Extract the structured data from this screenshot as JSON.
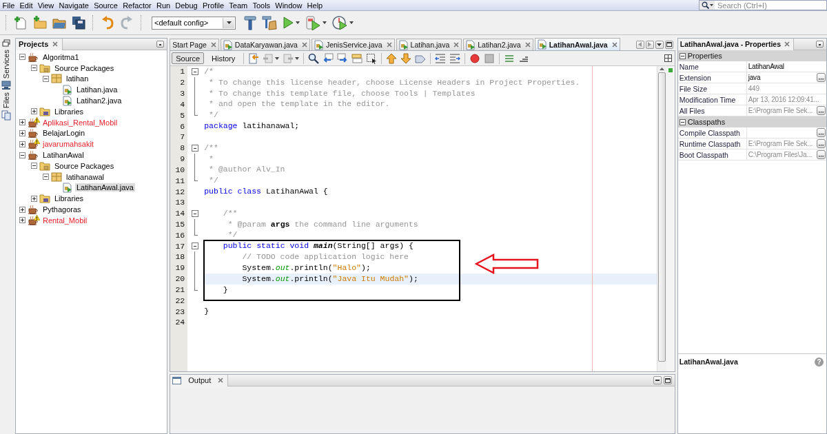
{
  "menu": [
    "File",
    "Edit",
    "View",
    "Navigate",
    "Source",
    "Refactor",
    "Run",
    "Debug",
    "Profile",
    "Team",
    "Tools",
    "Window",
    "Help"
  ],
  "search": {
    "placeholder": "Search (Ctrl+I)"
  },
  "toolbar": {
    "config": "<default config>"
  },
  "side_tabs": [
    {
      "label": "Services"
    },
    {
      "label": "Files"
    }
  ],
  "projects": {
    "title": "Projects",
    "tree": [
      {
        "label": "Algoritma1",
        "kind": "project",
        "expanded": true,
        "error": false,
        "selected": false,
        "children": [
          {
            "label": "Source Packages",
            "kind": "sources",
            "expanded": true,
            "selected": false,
            "children": [
              {
                "label": "latihan",
                "kind": "package",
                "expanded": true,
                "selected": false,
                "children": [
                  {
                    "label": "Latihan.java",
                    "kind": "file",
                    "selected": false
                  },
                  {
                    "label": "Latihan2.java",
                    "kind": "file",
                    "selected": false
                  }
                ]
              }
            ]
          },
          {
            "label": "Libraries",
            "kind": "libraries",
            "expanded": false,
            "selected": false
          }
        ]
      },
      {
        "label": "Aplikasi_Rental_Mobil",
        "kind": "project",
        "expanded": false,
        "error": true,
        "selected": false
      },
      {
        "label": "BelajarLogin",
        "kind": "project",
        "expanded": false,
        "error": false,
        "selected": false
      },
      {
        "label": "javarumahsakit",
        "kind": "project",
        "expanded": false,
        "error": true,
        "selected": false
      },
      {
        "label": "LatihanAwal",
        "kind": "project",
        "expanded": true,
        "error": false,
        "selected": false,
        "children": [
          {
            "label": "Source Packages",
            "kind": "sources",
            "expanded": true,
            "selected": false,
            "children": [
              {
                "label": "latihanawal",
                "kind": "package",
                "expanded": true,
                "selected": false,
                "children": [
                  {
                    "label": "LatihanAwal.java",
                    "kind": "file",
                    "selected": true
                  }
                ]
              }
            ]
          },
          {
            "label": "Libraries",
            "kind": "libraries",
            "expanded": false,
            "selected": false
          }
        ]
      },
      {
        "label": "Pythagoras",
        "kind": "project",
        "expanded": false,
        "error": false,
        "selected": false
      },
      {
        "label": "Rental_Mobil",
        "kind": "project",
        "expanded": false,
        "error": true,
        "selected": false
      }
    ]
  },
  "editor": {
    "tabs": [
      {
        "label": "Start Page",
        "kind": "start",
        "selected": false
      },
      {
        "label": "DataKaryawan.java",
        "kind": "java",
        "selected": false
      },
      {
        "label": "JenisService.java",
        "kind": "java",
        "selected": false
      },
      {
        "label": "Latihan.java",
        "kind": "java",
        "selected": false
      },
      {
        "label": "Latihan2.java",
        "kind": "java",
        "selected": false
      },
      {
        "label": "LatihanAwal.java",
        "kind": "java",
        "selected": true
      }
    ],
    "views": [
      {
        "label": "Source",
        "selected": true
      },
      {
        "label": "History",
        "selected": false
      }
    ],
    "lines": [
      {
        "number": "1",
        "foldable": true,
        "highlighted": false,
        "tokens": [
          {
            "kind": "comment",
            "text": "/*"
          }
        ]
      },
      {
        "number": "2",
        "highlighted": false,
        "tokens": [
          {
            "kind": "comment",
            "text": " * To change this license header, choose License Headers in Project Properties."
          }
        ]
      },
      {
        "number": "3",
        "highlighted": false,
        "tokens": [
          {
            "kind": "comment",
            "text": " * To change this template file, choose Tools | Templates"
          }
        ]
      },
      {
        "number": "4",
        "highlighted": false,
        "tokens": [
          {
            "kind": "comment",
            "text": " * and open the template in the editor."
          }
        ]
      },
      {
        "number": "5",
        "fold_end": true,
        "highlighted": false,
        "tokens": [
          {
            "kind": "comment",
            "text": " */"
          }
        ]
      },
      {
        "number": "6",
        "highlighted": false,
        "tokens": [
          {
            "kind": "keyword",
            "text": "package"
          },
          {
            "kind": "plain",
            "text": " latihanawal;"
          }
        ]
      },
      {
        "number": "7",
        "highlighted": false
      },
      {
        "number": "8",
        "foldable": true,
        "highlighted": false,
        "tokens": [
          {
            "kind": "comment",
            "text": "/**"
          }
        ]
      },
      {
        "number": "9",
        "highlighted": false,
        "tokens": [
          {
            "kind": "comment",
            "text": " *"
          }
        ]
      },
      {
        "number": "10",
        "highlighted": false,
        "tokens": [
          {
            "kind": "comment",
            "text": " * @author Alv_In"
          }
        ]
      },
      {
        "number": "11",
        "fold_end": true,
        "highlighted": false,
        "tokens": [
          {
            "kind": "comment",
            "text": " */"
          }
        ]
      },
      {
        "number": "12",
        "highlighted": false,
        "tokens": [
          {
            "kind": "keyword",
            "text": "public "
          },
          {
            "kind": "keyword",
            "text": "class "
          },
          {
            "kind": "plain",
            "text": "LatihanAwal {"
          }
        ]
      },
      {
        "number": "13",
        "highlighted": false
      },
      {
        "number": "14",
        "foldable": true,
        "highlighted": false,
        "tokens": [
          {
            "kind": "comment",
            "text": "    /**"
          }
        ]
      },
      {
        "number": "15",
        "highlighted": false,
        "tokens": [
          {
            "kind": "comment",
            "text": "     * @param "
          },
          {
            "kind": "param",
            "text": "args"
          },
          {
            "kind": "comment",
            "text": " the command line arguments"
          }
        ]
      },
      {
        "number": "16",
        "fold_end": true,
        "highlighted": false,
        "tokens": [
          {
            "kind": "comment",
            "text": "     */"
          }
        ]
      },
      {
        "number": "17",
        "foldable": true,
        "highlighted": false,
        "tokens": [
          {
            "kind": "keyword",
            "text": "    public "
          },
          {
            "kind": "keyword",
            "text": "static "
          },
          {
            "kind": "keyword",
            "text": "void "
          },
          {
            "kind": "method",
            "text": "main"
          },
          {
            "kind": "plain",
            "text": "(String[] args) {"
          }
        ]
      },
      {
        "number": "18",
        "highlighted": false,
        "tokens": [
          {
            "kind": "comment",
            "text": "        // TODO code application logic here"
          }
        ]
      },
      {
        "number": "19",
        "highlighted": false,
        "tokens": [
          {
            "kind": "plain",
            "text": "        System."
          },
          {
            "kind": "field",
            "text": "out"
          },
          {
            "kind": "plain",
            "text": ".println("
          },
          {
            "kind": "string",
            "text": "\"Halo\""
          },
          {
            "kind": "plain",
            "text": ");"
          }
        ]
      },
      {
        "number": "20",
        "highlighted": true,
        "tokens": [
          {
            "kind": "plain",
            "text": "        System."
          },
          {
            "kind": "field",
            "text": "out"
          },
          {
            "kind": "plain",
            "text": ".println("
          },
          {
            "kind": "string",
            "text": "\"Java Itu Mudah\""
          },
          {
            "kind": "plain",
            "text": ");"
          }
        ]
      },
      {
        "number": "21",
        "fold_end": true,
        "highlighted": false,
        "tokens": [
          {
            "kind": "plain",
            "text": "    }"
          }
        ]
      },
      {
        "number": "22",
        "highlighted": false
      },
      {
        "number": "23",
        "highlighted": false,
        "tokens": [
          {
            "kind": "plain",
            "text": "}"
          }
        ]
      },
      {
        "number": "24",
        "highlighted": false
      }
    ]
  },
  "output": {
    "title": "Output"
  },
  "properties": {
    "title": "LatihanAwal.java - Properties",
    "sections": [
      {
        "title": "Properties",
        "expanded": true,
        "rows": [
          {
            "name": "Name",
            "value": "LatihanAwal",
            "read_only": false,
            "custom_editor": false
          },
          {
            "name": "Extension",
            "value": "java",
            "read_only": false,
            "custom_editor": true
          },
          {
            "name": "File Size",
            "value": "449",
            "read_only": true,
            "custom_editor": false
          },
          {
            "name": "Modification Time",
            "value": "Apr 13, 2016 12:09:41...",
            "read_only": true,
            "custom_editor": false
          },
          {
            "name": "All Files",
            "value": "E:\\Program File Sek...",
            "read_only": true,
            "custom_editor": true
          }
        ]
      },
      {
        "title": "Classpaths",
        "expanded": true,
        "rows": [
          {
            "name": "Compile Classpath",
            "custom_editor": true
          },
          {
            "name": "Runtime Classpath",
            "value": "E:\\Program File Sek...",
            "read_only": true,
            "custom_editor": true
          },
          {
            "name": "Boot Classpath",
            "value": "C:\\Program Files\\Ja...",
            "read_only": true,
            "custom_editor": true
          }
        ]
      }
    ],
    "footer": "LatihanAwal.java",
    "help": "?"
  }
}
